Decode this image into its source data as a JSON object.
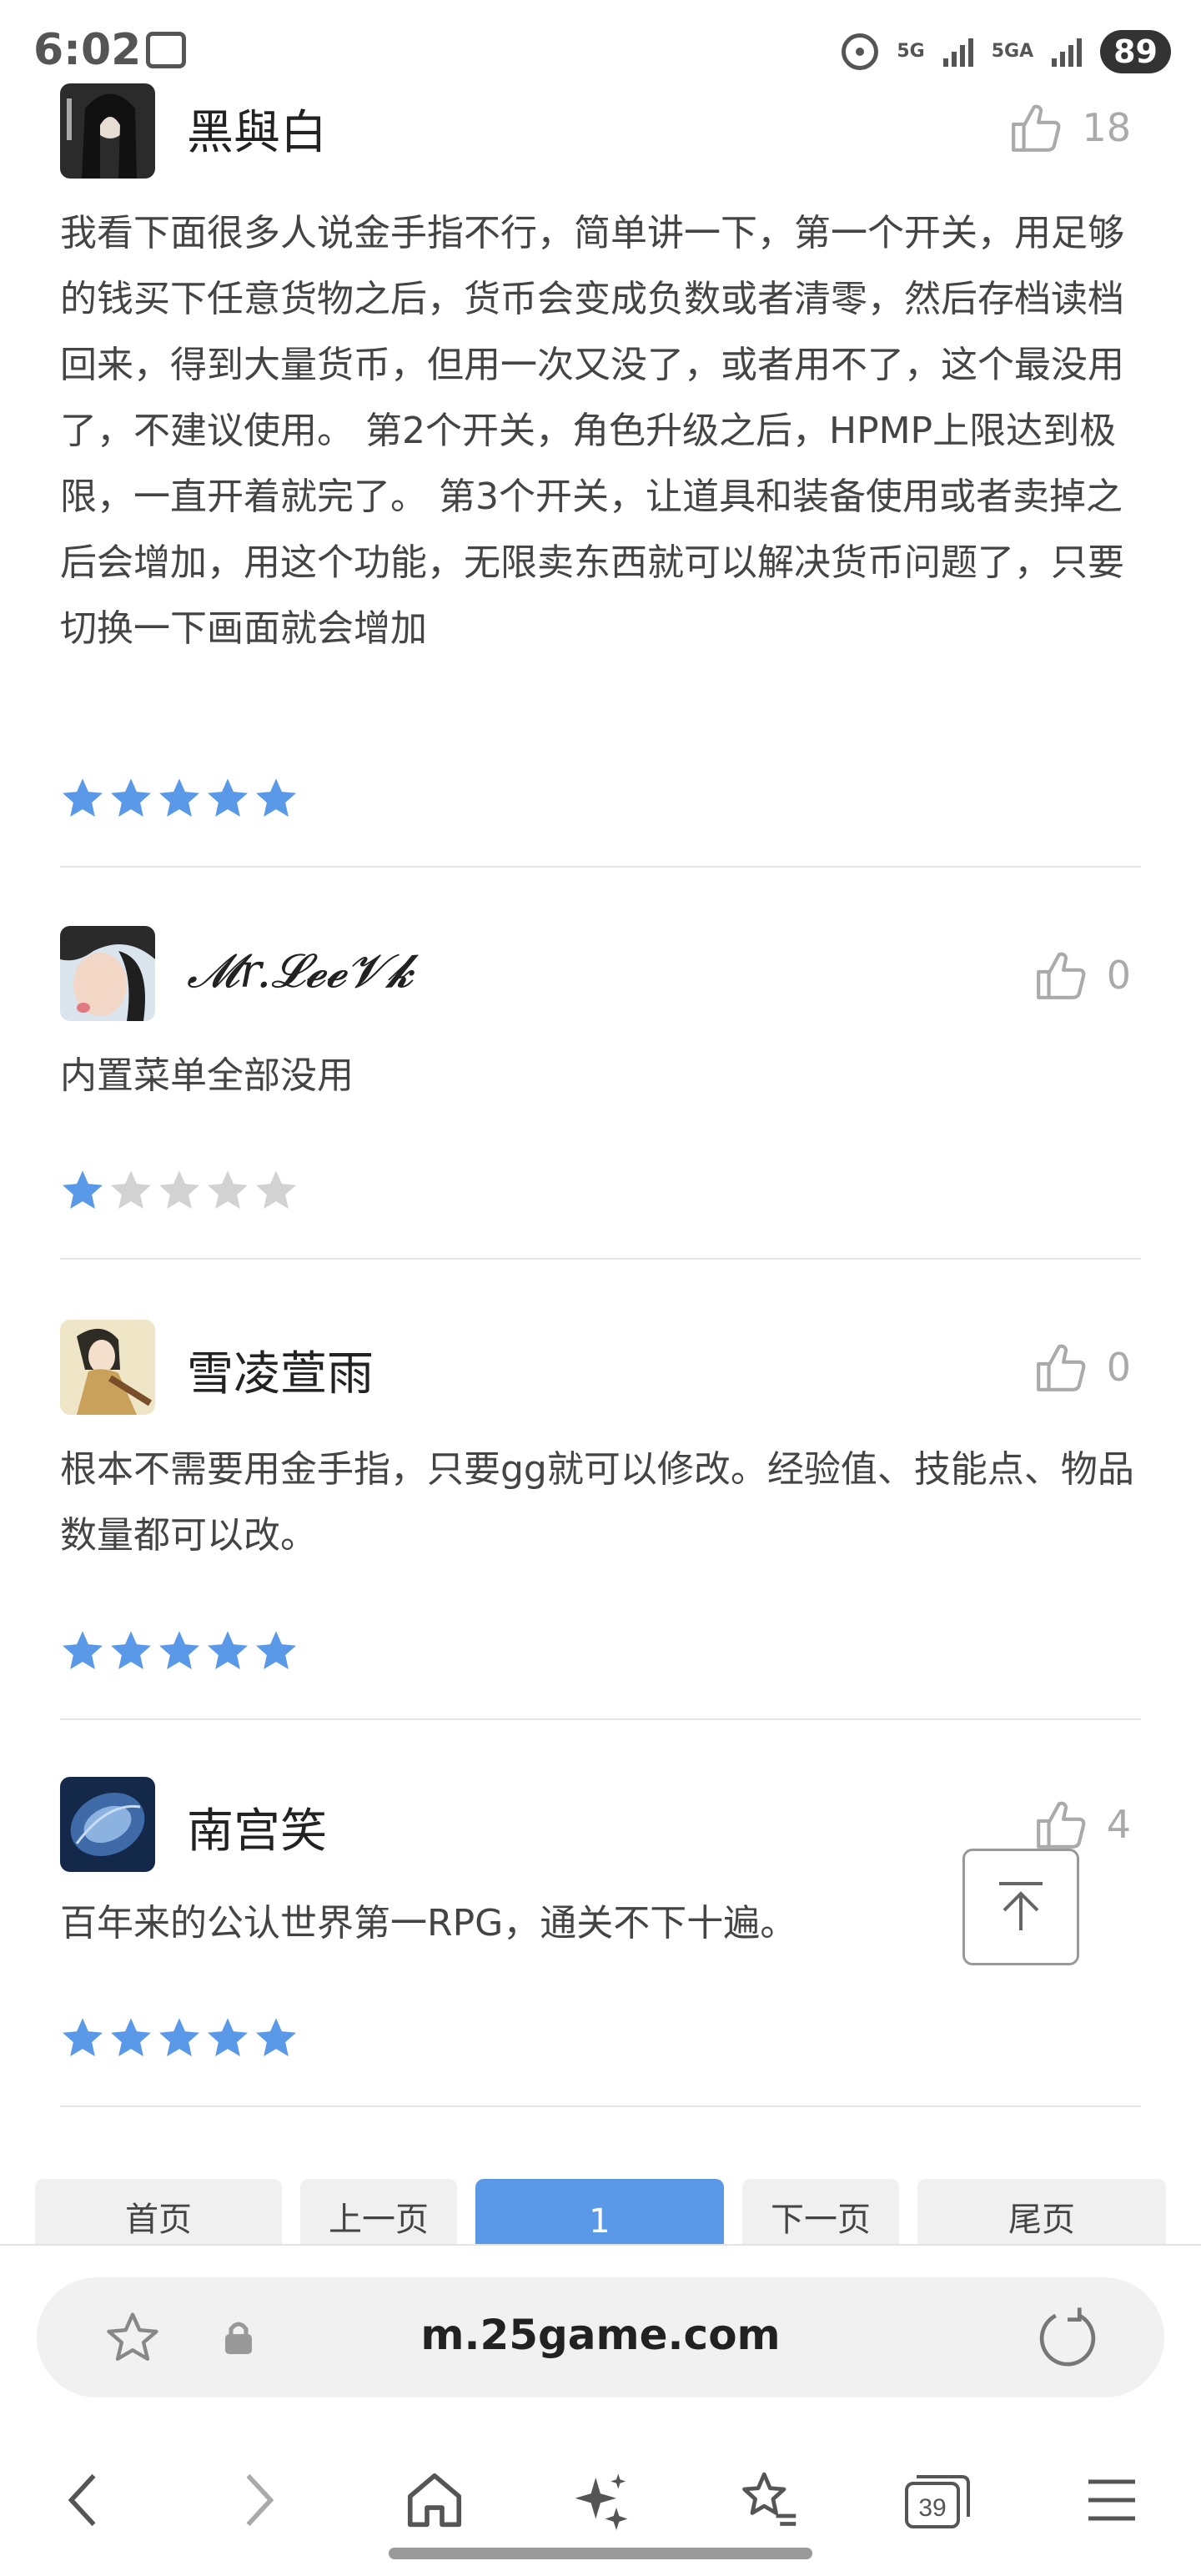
{
  "status_bar": {
    "time": "6:02",
    "net1": "5G",
    "net2": "5GA",
    "battery": "89"
  },
  "reviews": [
    {
      "author": "黑與白",
      "likes": "18",
      "text": "我看下面很多人说金手指不行，简单讲一下，第一个开关，用足够的钱买下任意货物之后，货币会变成负数或者清零，然后存档读档回来，得到大量货币，但用一次又没了，或者用不了，这个最没用了，不建议使用。 第2个开关，角色升级之后，HPMP上限达到极限，一直开着就完了。 第3个开关，让道具和装备使用或者卖掉之后会增加，用这个功能，无限卖东西就可以解决货币问题了，只要切换一下画面就会增加",
      "rating": 5
    },
    {
      "author": "𝓜r.𝓛𝓮𝓮𝓥𝓴",
      "likes": "0",
      "text": "内置菜单全部没用",
      "rating": 1
    },
    {
      "author": "雪凌萱雨",
      "likes": "0",
      "text": "根本不需要用金手指，只要gg就可以修改。经验值、技能点、物品数量都可以改。",
      "rating": 5
    },
    {
      "author": "南宫笑",
      "likes": "4",
      "text": "百年来的公认世界第一RPG，通关不下十遍。",
      "rating": 5
    }
  ],
  "pager": {
    "first": "首页",
    "prev": "上一页",
    "current": "1",
    "next": "下一页",
    "last": "尾页"
  },
  "browser": {
    "url": "m.25game.com",
    "tab_count": "39"
  },
  "colors": {
    "star_filled": "#5a99e8",
    "star_empty": "#d2d2d2",
    "pager_active": "#5a99e8"
  }
}
